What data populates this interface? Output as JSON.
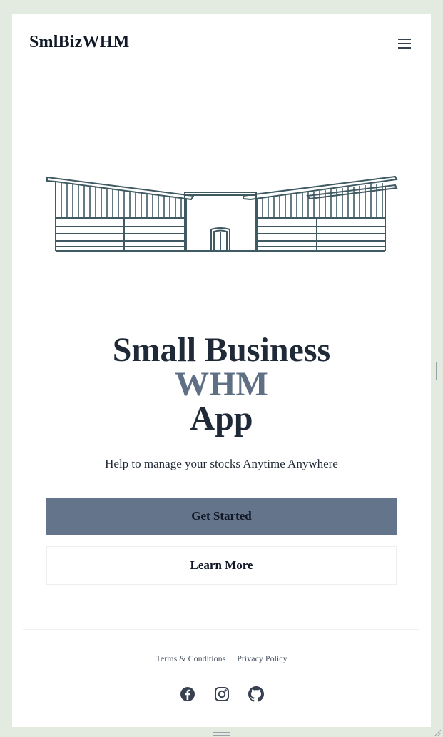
{
  "navbar": {
    "brand": "SmlBizWHM",
    "menu_icon": "hamburger-menu-icon"
  },
  "hero": {
    "illustration_icon": "warehouse-illustration",
    "title_line1": "Small Business",
    "title_line2": "WHM",
    "title_line3": "App",
    "subtitle": "Help to manage your stocks Anytime Anywhere"
  },
  "buttons": {
    "primary_label": "Get Started",
    "secondary_label": "Learn More"
  },
  "footer": {
    "links": [
      "Terms & Conditions",
      "Privacy Policy"
    ],
    "social_icons": [
      "facebook-icon",
      "instagram-icon",
      "github-icon"
    ]
  },
  "colors": {
    "background": "#e3eadf",
    "page": "#ffffff",
    "text": "#1f2937",
    "accent": "#5f7085",
    "button_primary": "#64748b",
    "illustration_stroke": "#3f5a63"
  }
}
